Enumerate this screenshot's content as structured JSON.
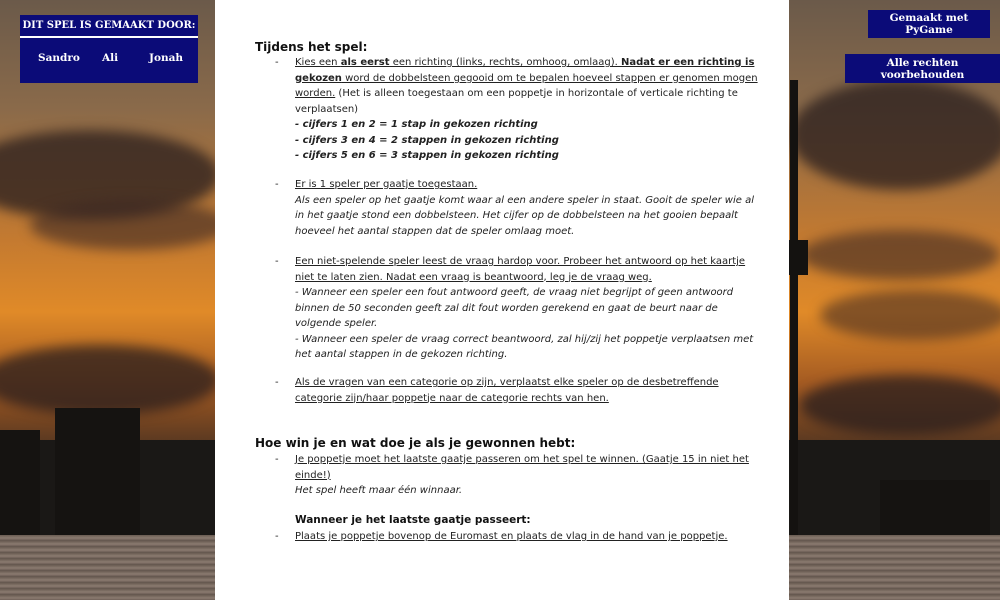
{
  "credits": {
    "title": "DIT SPEL IS GEMAAKT DOOR:",
    "names": [
      "Sandro",
      "Ali",
      "Jonah"
    ]
  },
  "badges": {
    "pygame": "Gemaakt met PyGame",
    "rights": "Alle rechten voorbehouden"
  },
  "doc": {
    "section1_title": "Tijdens het spel:",
    "item1": {
      "line1a": "Kies een ",
      "line1b": "als eerst",
      "line1c": " een richting (links, rechts, omhoog, omlaag). ",
      "line1d": "Nadat er een richting is gekozen",
      "line1e": " word de dobbelsteen gegooid om te bepalen hoeveel stappen er genomen mogen worden.",
      "line2": " (Het is alleen toegestaan om een poppetje in horizontale of verticale richting te verplaatsen)",
      "rule1": "- cijfers 1 en 2 = 1 stap in gekozen richting",
      "rule2": "- cijfers 3 en 4 = 2 stappen in gekozen richting",
      "rule3": "- cijfers 5 en 6 = 3 stappen in gekozen richting"
    },
    "item2": {
      "main": "Er is 1 speler per gaatje toegestaan.",
      "detail": "Als een speler op het gaatje komt waar al een andere speler in staat. Gooit de speler wie al in het gaatje stond een dobbelsteen. Het cijfer op de dobbelsteen na het gooien bepaalt hoeveel het aantal stappen dat de speler omlaag moet."
    },
    "item3": {
      "main": "Een niet-spelende speler leest de vraag hardop voor.  Probeer het antwoord op het kaartje niet te laten zien. Nadat een vraag is beantwoord, leg je de vraag weg.",
      "wrong": "- Wanneer een speler een fout antwoord geeft, de vraag niet begrijpt of geen antwoord binnen de 50 seconden geeft zal dit fout worden gerekend en gaat de beurt naar de volgende speler.",
      "right": "- Wanneer een speler de vraag correct beantwoord, zal hij/zij het poppetje verplaatsen met het aantal stappen in de gekozen richting."
    },
    "item4": {
      "main": "Als de vragen van een categorie op zijn, verplaatst elke speler op de desbetreffende categorie zijn/haar poppetje naar de categorie rechts van hen."
    },
    "section2_title": "Hoe win je en wat doe je als je gewonnen hebt:",
    "item5": {
      "main": "Je poppetje moet het laatste gaatje passeren om het spel te winnen. (Gaatje 15 in niet het einde!)",
      "detail": "Het spel heeft maar één winnaar."
    },
    "sub_title": "Wanneer je het laatste gaatje passeert:",
    "item6": {
      "main": "Plaats je poppetje bovenop de Euromast en plaats de vlag in de hand van je poppetje."
    }
  }
}
